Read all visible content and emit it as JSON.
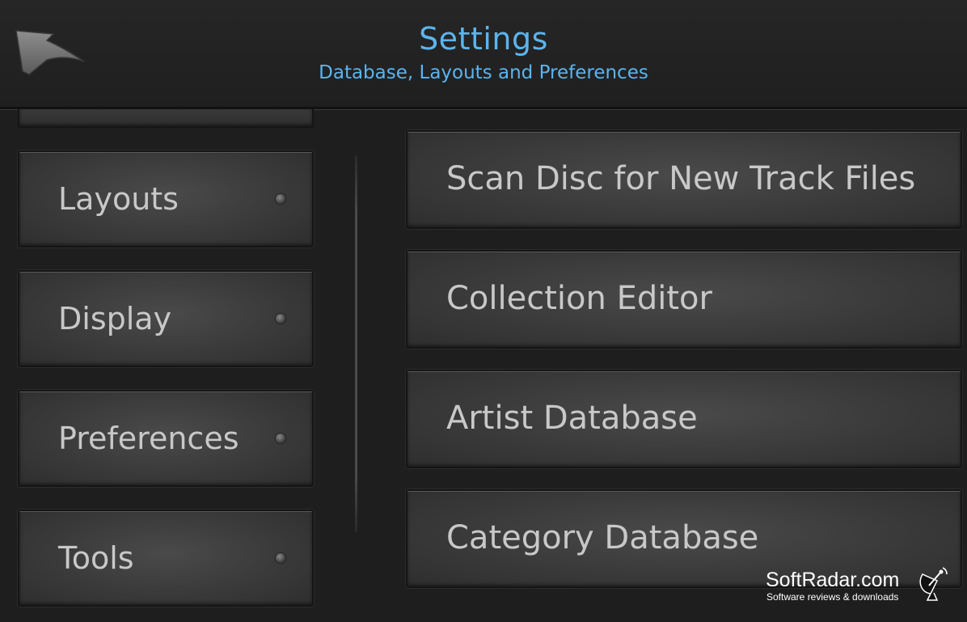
{
  "header": {
    "title": "Settings",
    "subtitle": "Database, Layouts and Preferences",
    "back_icon": "back-arrow-icon",
    "accent_color": "#5cb4ee"
  },
  "sidebar": {
    "items": [
      {
        "label": "Layouts"
      },
      {
        "label": "Display"
      },
      {
        "label": "Preferences"
      },
      {
        "label": "Tools"
      }
    ]
  },
  "main": {
    "items": [
      {
        "label": "Scan Disc for New Track Files"
      },
      {
        "label": "Collection Editor"
      },
      {
        "label": "Artist Database"
      },
      {
        "label": "Category Database"
      }
    ]
  },
  "watermark": {
    "name": "SoftRadar.com",
    "tagline": "Software reviews & downloads"
  }
}
